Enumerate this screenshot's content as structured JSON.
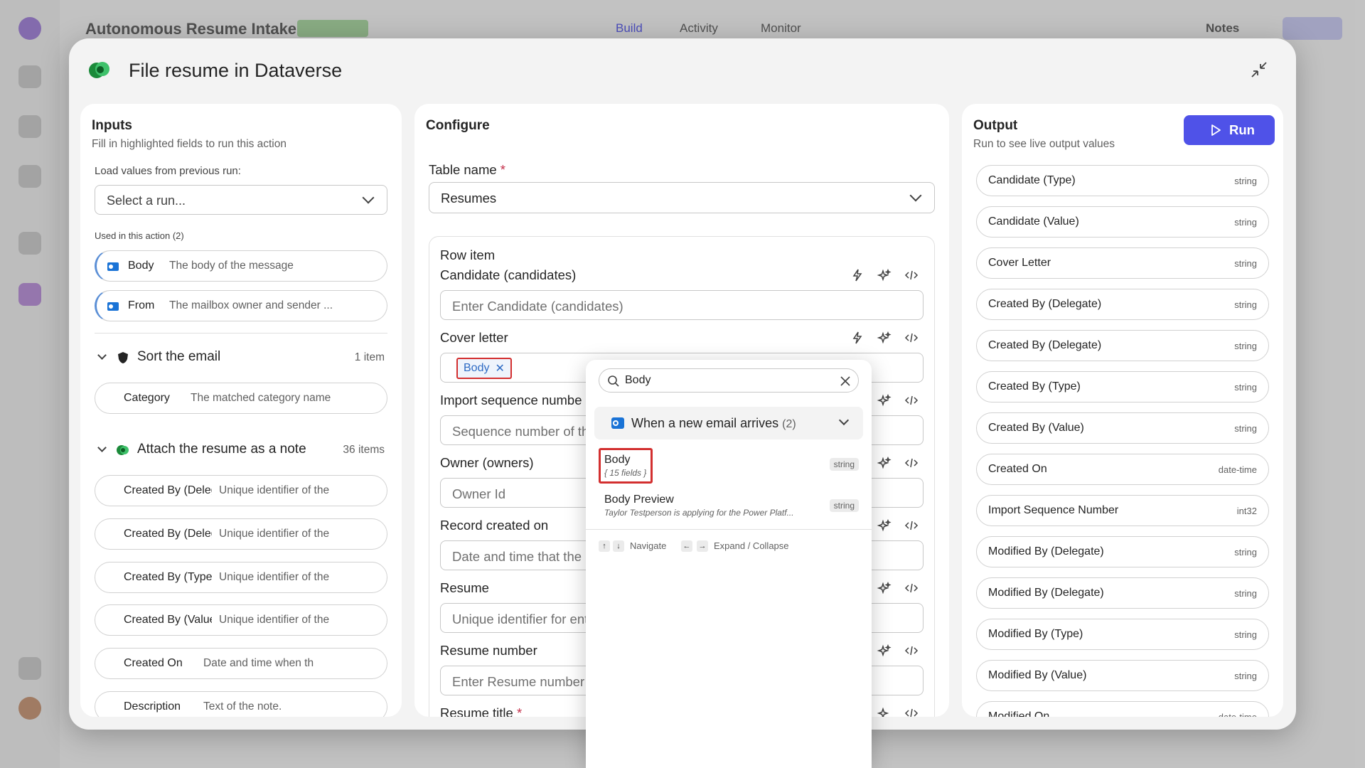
{
  "background": {
    "app_title": "Autonomous Resume Intake",
    "tabs": [
      "Build",
      "Activity",
      "Monitor"
    ],
    "user_label": "Notes"
  },
  "modal": {
    "title": "File resume in Dataverse"
  },
  "inputs": {
    "title": "Inputs",
    "subtitle": "Fill in highlighted fields to run this action",
    "load_label": "Load values from previous run:",
    "select_run": "Select a run...",
    "used_label": "Used in this action (2)",
    "used": [
      {
        "name": "Body",
        "desc": "The body of the message",
        "icon": "outlook-icon"
      },
      {
        "name": "From",
        "desc": "The mailbox owner and sender ...",
        "icon": "outlook-icon"
      }
    ],
    "sections": [
      {
        "title": "Sort the email",
        "count": "1 item",
        "icon": "shield-icon",
        "fields": [
          {
            "name": "Category",
            "desc": "The matched category name"
          }
        ]
      },
      {
        "title": "Attach the resume as a note",
        "count": "36 items",
        "icon": "dataverse-icon",
        "fields": [
          {
            "name": "Created By (Delegate)",
            "desc": "Unique identifier of the"
          },
          {
            "name": "Created By (Delegate)",
            "desc": "Unique identifier of the"
          },
          {
            "name": "Created By (Type)",
            "desc": "Unique identifier of the"
          },
          {
            "name": "Created By (Value)",
            "desc": "Unique identifier of the"
          },
          {
            "name": "Created On",
            "desc": "Date and time when th"
          },
          {
            "name": "Description",
            "desc": "Text of the note."
          }
        ]
      }
    ]
  },
  "configure": {
    "title": "Configure",
    "table_label": "Table name",
    "table_value": "Resumes",
    "row_item_label": "Row item",
    "fields": [
      {
        "label": "Candidate (candidates)",
        "placeholder": "Enter Candidate (candidates)",
        "required": false
      },
      {
        "label": "Cover letter",
        "placeholder": "",
        "required": false,
        "token": "Body"
      },
      {
        "label": "Import sequence number",
        "placeholder": "Sequence number of the import",
        "required": false
      },
      {
        "label": "Owner (owners)",
        "placeholder": "Owner Id",
        "required": false
      },
      {
        "label": "Record created on",
        "placeholder": "Date and time that the record was migrated",
        "required": false
      },
      {
        "label": "Resume",
        "placeholder": "Unique identifier for entity instances",
        "required": false
      },
      {
        "label": "Resume number",
        "placeholder": "Enter Resume number",
        "required": false
      },
      {
        "label": "Resume title",
        "placeholder": "",
        "required": true
      }
    ]
  },
  "output": {
    "title": "Output",
    "subtitle": "Run to see live output values",
    "run_label": "Run",
    "rows": [
      {
        "name": "Candidate (Type)",
        "type": "string"
      },
      {
        "name": "Candidate (Value)",
        "type": "string"
      },
      {
        "name": "Cover Letter",
        "type": "string"
      },
      {
        "name": "Created By (Delegate)",
        "type": "string"
      },
      {
        "name": "Created By (Delegate)",
        "type": "string"
      },
      {
        "name": "Created By (Type)",
        "type": "string"
      },
      {
        "name": "Created By (Value)",
        "type": "string"
      },
      {
        "name": "Created On",
        "type": "date-time"
      },
      {
        "name": "Import Sequence Number",
        "type": "int32"
      },
      {
        "name": "Modified By (Delegate)",
        "type": "string"
      },
      {
        "name": "Modified By (Delegate)",
        "type": "string"
      },
      {
        "name": "Modified By (Type)",
        "type": "string"
      },
      {
        "name": "Modified By (Value)",
        "type": "string"
      },
      {
        "name": "Modified On",
        "type": "date-time"
      }
    ]
  },
  "popup": {
    "search_value": "Body",
    "group_name": "When a new email arrives",
    "group_count": "(2)",
    "items": [
      {
        "name": "Body",
        "sub": "{ 15 fields }",
        "type": "string"
      },
      {
        "name": "Body Preview",
        "sub": "Taylor Testperson is applying for the Power Platf...",
        "type": "string"
      }
    ],
    "hint_navigate": "Navigate",
    "hint_expand": "Expand / Collapse"
  },
  "colors": {
    "accent": "#4f52e8",
    "highlight": "#d32f2f",
    "token_text": "#2e6bc4"
  }
}
